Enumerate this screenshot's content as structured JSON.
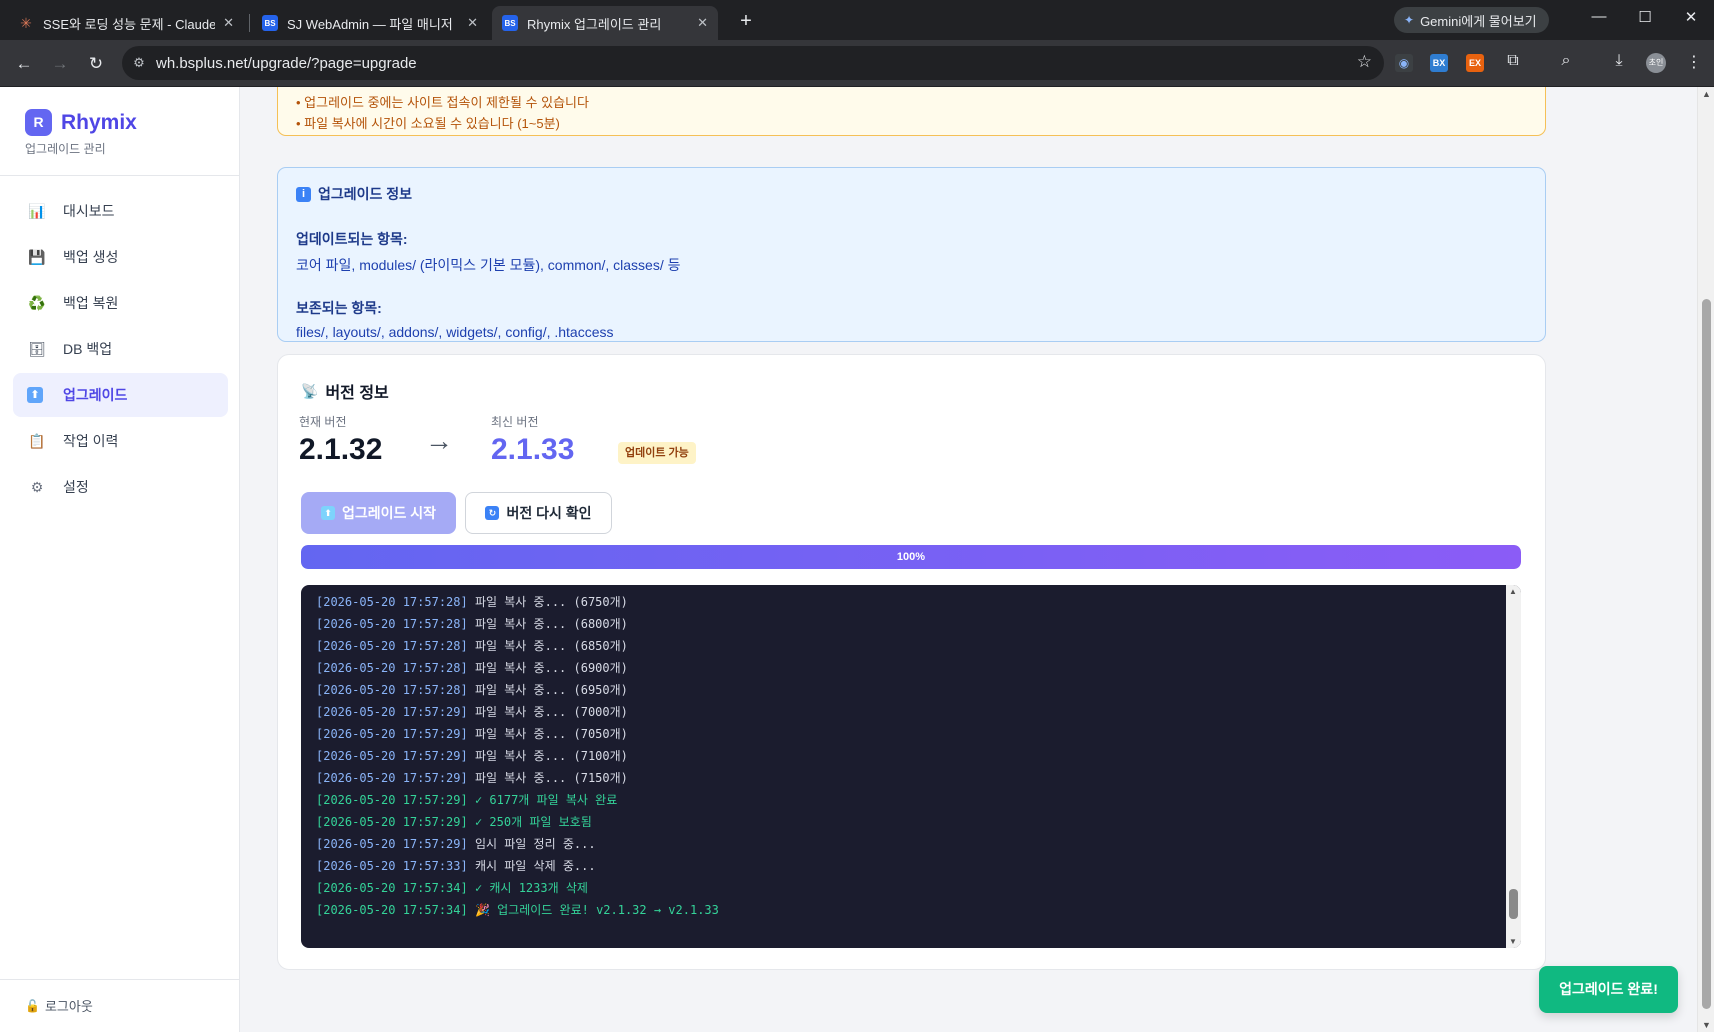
{
  "browser": {
    "tabs": [
      {
        "title": "SSE와 로딩 성능 문제 - Claude",
        "favicon": "claude-icon",
        "active": false
      },
      {
        "title": "SJ WebAdmin — 파일 매니저",
        "favicon": "BS",
        "active": false
      },
      {
        "title": "Rhymix 업그레이드 관리",
        "favicon": "BS",
        "active": true
      }
    ],
    "gemini_label": "Gemini에게 물어보기",
    "url": "wh.bsplus.net/upgrade/?page=upgrade",
    "extensions": [
      "BX",
      "EX"
    ],
    "profile_initials": "초인"
  },
  "sidebar": {
    "logo_letter": "R",
    "brand": "Rhymix",
    "subtitle": "업그레이드 관리",
    "items": [
      {
        "label": "대시보드",
        "icon": "chart-icon",
        "glyph": "📊",
        "active": false
      },
      {
        "label": "백업 생성",
        "icon": "floppy-disk-icon",
        "glyph": "💾",
        "active": false
      },
      {
        "label": "백업 복원",
        "icon": "recycle-icon",
        "glyph": "♻️",
        "active": false
      },
      {
        "label": "DB 백업",
        "icon": "database-icon",
        "glyph": "🗄",
        "active": false
      },
      {
        "label": "업그레이드",
        "icon": "up-arrow-icon",
        "glyph": "⬆",
        "active": true
      },
      {
        "label": "작업 이력",
        "icon": "clipboard-icon",
        "glyph": "📋",
        "active": false
      },
      {
        "label": "설정",
        "icon": "gear-icon",
        "glyph": "⚙",
        "active": false
      }
    ],
    "logout": "로그아웃"
  },
  "warning": {
    "lines": [
      "• 업그레이드 중에는 사이트 접속이 제한될 수 있습니다",
      "• 파일 복사에 시간이 소요될 수 있습니다 (1~5분)"
    ]
  },
  "info": {
    "title": "업그레이드 정보",
    "updated_label": "업데이트되는 항목:",
    "updated_text": "코어 파일, modules/ (라이믹스 기본 모듈), common/, classes/ 등",
    "preserved_label": "보존되는 항목:",
    "preserved_text": "files/, layouts/, addons/, widgets/, config/, .htaccess"
  },
  "version": {
    "title": "버전 정보",
    "current_label": "현재 버전",
    "current": "2.1.32",
    "arrow": "→",
    "latest_label": "최신 버전",
    "latest": "2.1.33",
    "badge": "업데이트 가능",
    "start_button": "업그레이드 시작",
    "recheck_button": "버전 다시 확인"
  },
  "progress": {
    "value": 100,
    "label": "100%"
  },
  "log": [
    {
      "ts": "[2026-05-20 17:57:28]",
      "msg": " 파일 복사 중... (6750개)",
      "ok": false
    },
    {
      "ts": "[2026-05-20 17:57:28]",
      "msg": " 파일 복사 중... (6800개)",
      "ok": false
    },
    {
      "ts": "[2026-05-20 17:57:28]",
      "msg": " 파일 복사 중... (6850개)",
      "ok": false
    },
    {
      "ts": "[2026-05-20 17:57:28]",
      "msg": " 파일 복사 중... (6900개)",
      "ok": false
    },
    {
      "ts": "[2026-05-20 17:57:28]",
      "msg": " 파일 복사 중... (6950개)",
      "ok": false
    },
    {
      "ts": "[2026-05-20 17:57:29]",
      "msg": " 파일 복사 중... (7000개)",
      "ok": false
    },
    {
      "ts": "[2026-05-20 17:57:29]",
      "msg": " 파일 복사 중... (7050개)",
      "ok": false
    },
    {
      "ts": "[2026-05-20 17:57:29]",
      "msg": " 파일 복사 중... (7100개)",
      "ok": false
    },
    {
      "ts": "[2026-05-20 17:57:29]",
      "msg": " 파일 복사 중... (7150개)",
      "ok": false
    },
    {
      "ts": "[2026-05-20 17:57:29]",
      "msg": " ✓ 6177개 파일 복사 완료",
      "ok": true
    },
    {
      "ts": "[2026-05-20 17:57:29]",
      "msg": " ✓ 250개 파일 보호됨",
      "ok": true
    },
    {
      "ts": "[2026-05-20 17:57:29]",
      "msg": " 임시 파일 정리 중...",
      "ok": false
    },
    {
      "ts": "[2026-05-20 17:57:33]",
      "msg": " 캐시 파일 삭제 중...",
      "ok": false
    },
    {
      "ts": "[2026-05-20 17:57:34]",
      "msg": " ✓ 캐시 1233개 삭제",
      "ok": true
    },
    {
      "ts": "[2026-05-20 17:57:34]",
      "msg": " 🎉 업그레이드 완료! v2.1.32 → v2.1.33",
      "ok": true
    }
  ],
  "toast": "업그레이드 완료!"
}
